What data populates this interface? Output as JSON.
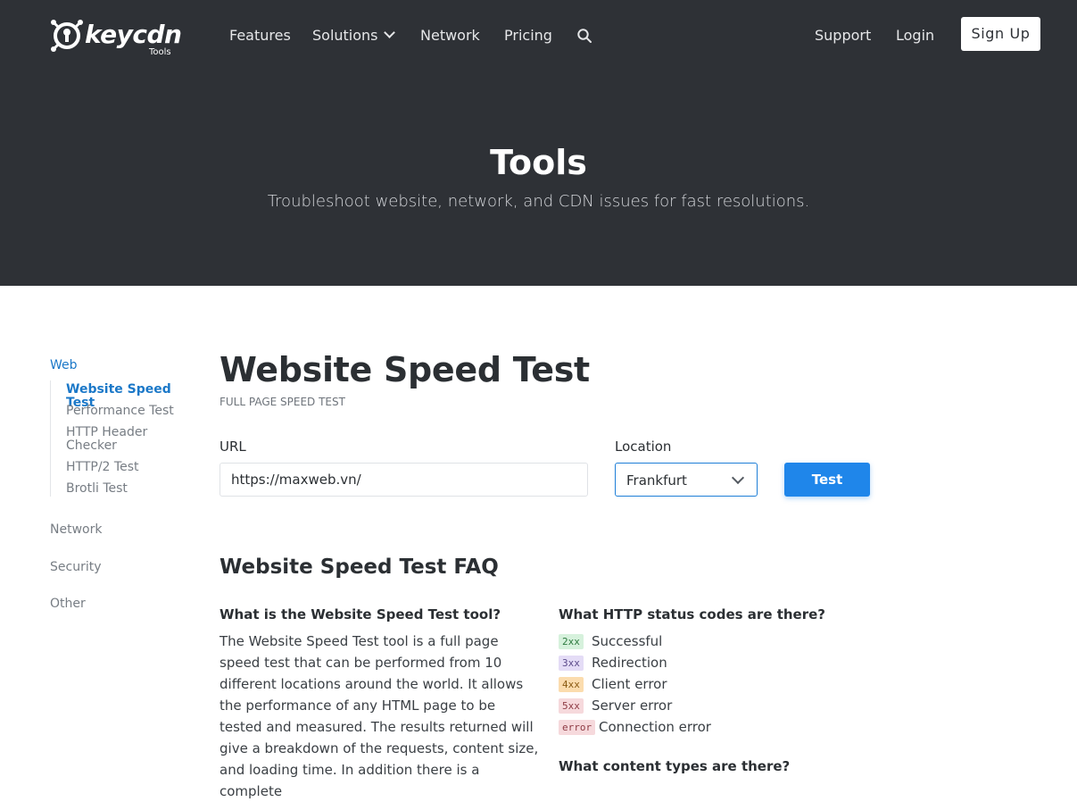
{
  "brand": {
    "name": "keycdn",
    "sub": "Tools"
  },
  "nav": {
    "features": "Features",
    "solutions": "Solutions",
    "network": "Network",
    "pricing": "Pricing",
    "support": "Support",
    "login": "Login",
    "signup": "Sign Up"
  },
  "hero": {
    "title": "Tools",
    "subtitle": "Troubleshoot website, network, and CDN issues for fast resolutions."
  },
  "sidebar": {
    "web": "Web",
    "web_items": [
      "Website Speed Test",
      "Performance Test",
      "HTTP Header Checker",
      "HTTP/2 Test",
      "Brotli Test"
    ],
    "network": "Network",
    "security": "Security",
    "other": "Other"
  },
  "main": {
    "title": "Website Speed Test",
    "kicker": "FULL PAGE SPEED TEST",
    "url_label": "URL",
    "url_value": "https://maxweb.vn/",
    "location_label": "Location",
    "location_value": "Frankfurt",
    "test_button": "Test"
  },
  "faq": {
    "title": "Website Speed Test FAQ",
    "q1": "What is the Website Speed Test tool?",
    "a1": "The Website Speed Test tool is a full page speed test that can be performed from 10 different locations around the world. It allows the performance of any HTML page to be tested and measured. The results returned will give a breakdown of the requests, content size, and loading time. In addition there is a complete",
    "q2": "What HTTP status codes are there?",
    "codes": [
      {
        "badge": "2xx",
        "text": "Successful",
        "bg": "#d6f1dc",
        "fg": "#2d7a3f"
      },
      {
        "badge": "3xx",
        "text": "Redirection",
        "bg": "#e4dcf6",
        "fg": "#5b4a8a"
      },
      {
        "badge": "4xx",
        "text": "Client error",
        "bg": "#fbdcae",
        "fg": "#8a5a12"
      },
      {
        "badge": "5xx",
        "text": "Server error",
        "bg": "#f6d9dc",
        "fg": "#8e3b44"
      },
      {
        "badge": "error",
        "text": "Connection error",
        "bg": "#f6d9dc",
        "fg": "#8e3b44"
      }
    ],
    "q3": "What content types are there?"
  },
  "colors": {
    "header_bg": "#2e3136",
    "accent": "#1f86ea",
    "link_active": "#1b78c8"
  }
}
